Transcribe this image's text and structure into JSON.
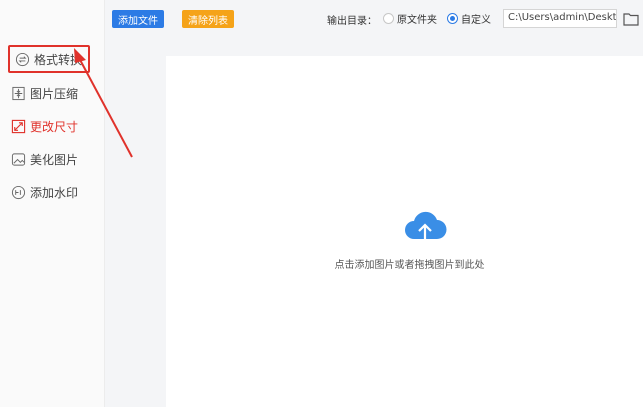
{
  "sidebar": {
    "items": [
      {
        "label": "格式转换",
        "icon": "format-convert-icon"
      },
      {
        "label": "图片压缩",
        "icon": "compress-icon"
      },
      {
        "label": "更改尺寸",
        "icon": "resize-icon"
      },
      {
        "label": "美化图片",
        "icon": "beautify-icon"
      },
      {
        "label": "添加水印",
        "icon": "watermark-icon"
      }
    ]
  },
  "toolbar": {
    "add_files_label": "添加文件",
    "clear_list_label": "清除列表",
    "output_dir_label": "输出目录：",
    "option_source_label": "原文件夹",
    "option_custom_label": "自定义",
    "output_path": "C:\\Users\\admin\\Deskto"
  },
  "main": {
    "drop_hint": "点击添加图片或者拖拽图片到此处"
  },
  "colors": {
    "primary": "#2c7be5",
    "warning": "#f5a319",
    "accent_red": "#e0322b"
  }
}
